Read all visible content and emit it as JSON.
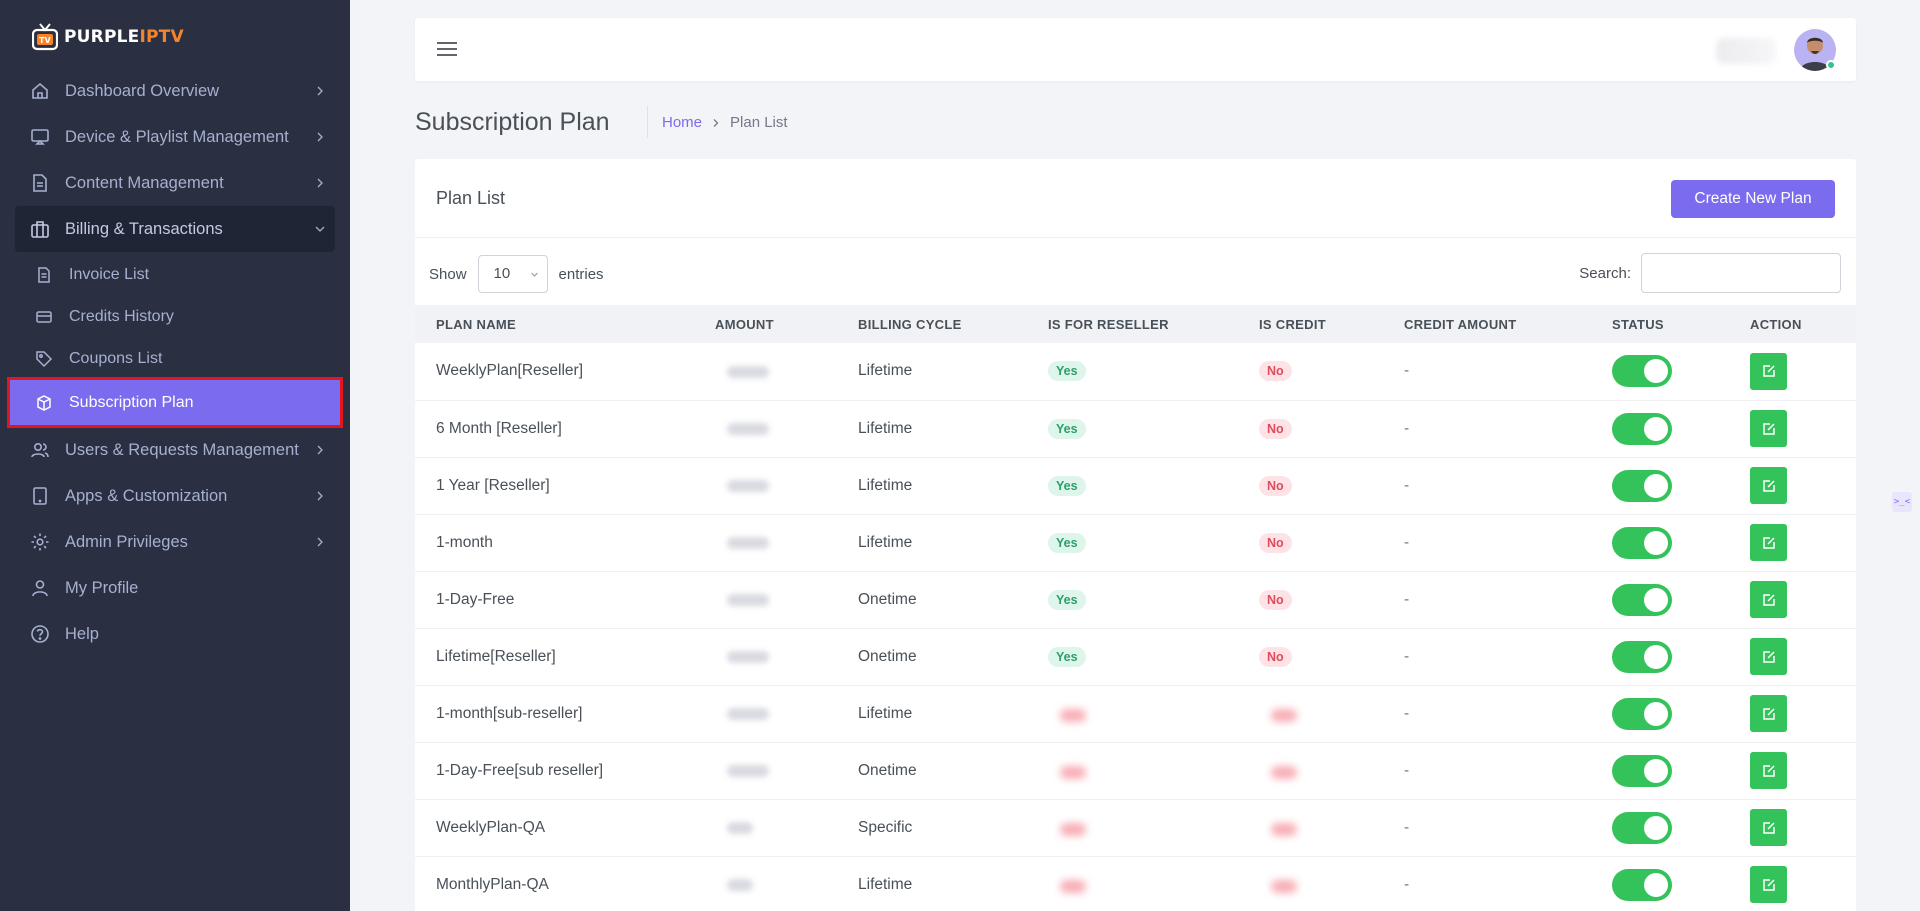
{
  "brand": {
    "word1": "PURPLE",
    "word2": "IPTV",
    "colors": {
      "white": "#ffffff",
      "orange": "#f4832a"
    }
  },
  "sidebar": {
    "items": [
      {
        "label": "Dashboard Overview",
        "icon": "home-icon"
      },
      {
        "label": "Device & Playlist Management",
        "icon": "monitor-icon"
      },
      {
        "label": "Content Management",
        "icon": "file-icon"
      },
      {
        "label": "Billing & Transactions",
        "icon": "briefcase-icon"
      },
      {
        "label": "Users & Requests Management",
        "icon": "users-icon"
      },
      {
        "label": "Apps & Customization",
        "icon": "tablet-icon"
      },
      {
        "label": "Admin Privileges",
        "icon": "gear-icon"
      },
      {
        "label": "My Profile",
        "icon": "user-icon"
      },
      {
        "label": "Help",
        "icon": "help-circle-icon"
      }
    ],
    "billing_sub": [
      {
        "label": "Invoice List",
        "icon": "file-text-icon"
      },
      {
        "label": "Credits History",
        "icon": "credit-card-icon"
      },
      {
        "label": "Coupons List",
        "icon": "tag-icon"
      },
      {
        "label": "Subscription Plan",
        "icon": "box-icon",
        "active": true
      }
    ]
  },
  "page": {
    "title": "Subscription Plan",
    "breadcrumb": {
      "home": "Home",
      "current": "Plan List"
    }
  },
  "card": {
    "title": "Plan List",
    "create_button": "Create New Plan",
    "show_label": "Show",
    "entries_value": "10",
    "entries_label": "entries",
    "search_label": "Search:",
    "search_value": ""
  },
  "table": {
    "headers": [
      "PLAN NAME",
      "AMOUNT",
      "BILLING CYCLE",
      "IS FOR RESELLER",
      "IS CREDIT",
      "CREDIT AMOUNT",
      "STATUS",
      "ACTION"
    ],
    "rows": [
      {
        "name": "WeeklyPlan[Reseller]",
        "cycle": "Lifetime",
        "reseller": "Yes",
        "credit": "No",
        "credit_amount": "-",
        "status_on": true
      },
      {
        "name": "6 Month [Reseller]",
        "cycle": "Lifetime",
        "reseller": "Yes",
        "credit": "No",
        "credit_amount": "-",
        "status_on": true
      },
      {
        "name": "1 Year [Reseller]",
        "cycle": "Lifetime",
        "reseller": "Yes",
        "credit": "No",
        "credit_amount": "-",
        "status_on": true
      },
      {
        "name": "1-month",
        "cycle": "Lifetime",
        "reseller": "Yes",
        "credit": "No",
        "credit_amount": "-",
        "status_on": true
      },
      {
        "name": "1-Day-Free",
        "cycle": "Onetime",
        "reseller": "Yes",
        "credit": "No",
        "credit_amount": "-",
        "status_on": true
      },
      {
        "name": "Lifetime[Reseller]",
        "cycle": "Onetime",
        "reseller": "Yes",
        "credit": "No",
        "credit_amount": "-",
        "status_on": true
      },
      {
        "name": "1-month[sub-reseller]",
        "cycle": "Lifetime",
        "reseller": "",
        "credit": "",
        "credit_amount": "-",
        "status_on": true
      },
      {
        "name": "1-Day-Free[sub reseller]",
        "cycle": "Onetime",
        "reseller": "",
        "credit": "",
        "credit_amount": "-",
        "status_on": true
      },
      {
        "name": "WeeklyPlan-QA",
        "cycle": "Specific",
        "reseller": "",
        "credit": "",
        "credit_amount": "-",
        "status_on": true
      },
      {
        "name": "MonthlyPlan-QA",
        "cycle": "Lifetime",
        "reseller": "",
        "credit": "",
        "credit_amount": "-",
        "status_on": true
      }
    ]
  },
  "colors": {
    "accent": "#7b6bef",
    "success": "#34c35a",
    "sidebar_bg": "#2a3042",
    "highlight_outline": "#e3161e"
  }
}
